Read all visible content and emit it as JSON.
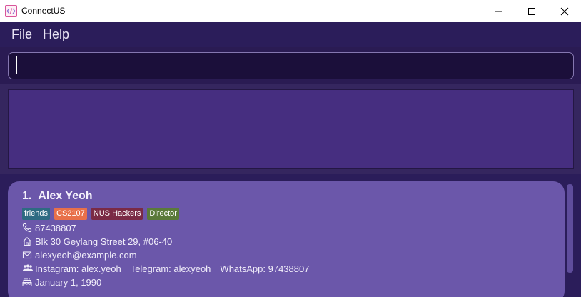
{
  "window": {
    "title": "ConnectUS",
    "app_icon": "code-brackets-icon"
  },
  "menu": {
    "file_label": "File",
    "help_label": "Help"
  },
  "command_box": {
    "value": "",
    "placeholder": ""
  },
  "result_display": {
    "text": ""
  },
  "persons": [
    {
      "index": "1.",
      "name": "Alex Yeoh",
      "tags": [
        {
          "label": "friends",
          "color": "#2e6b82"
        },
        {
          "label": "CS2107",
          "color": "#e8704a"
        },
        {
          "label": "NUS Hackers",
          "color": "#7a2a45"
        },
        {
          "label": "Director",
          "color": "#5a7a3a"
        }
      ],
      "phone": "87438807",
      "address": "Blk 30 Geylang Street 29, #06-40",
      "email": "alexyeoh@example.com",
      "instagram": "Instagram: alex.yeoh",
      "telegram": "Telegram: alexyeoh",
      "whatsapp": "WhatsApp: 97438807",
      "birthday": "January 1, 1990"
    }
  ],
  "colors": {
    "background": "#2a1c56",
    "card": "#6b57aa",
    "result_box": "#462e80",
    "command_box": "#1b0f3a"
  }
}
